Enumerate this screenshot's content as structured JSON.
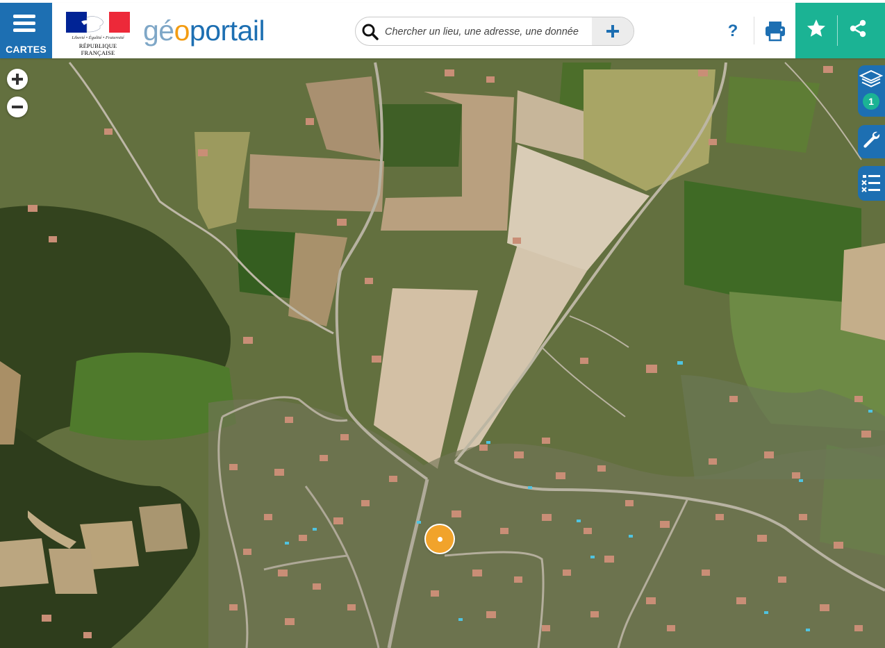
{
  "menu": {
    "label": "CARTES"
  },
  "branding": {
    "republic_devise": "Liberté • Égalité • Fraternité",
    "republic_name": "RÉPUBLIQUE FRANÇAISE",
    "logo_parts": [
      "gé",
      "o",
      "portail"
    ]
  },
  "search": {
    "placeholder": "Chercher un lieu, une adresse, une donnée",
    "value": ""
  },
  "toolbar": {
    "help_label": "?",
    "icons": [
      "print-icon",
      "star-icon",
      "share-icon"
    ]
  },
  "map_controls": {
    "zoom_in": "zoom-in-icon",
    "zoom_out": "zoom-out-icon"
  },
  "side_tabs": [
    {
      "icon": "layers-icon",
      "badge": "1"
    },
    {
      "icon": "wrench-icon"
    },
    {
      "icon": "legend-list-icon"
    }
  ],
  "colors": {
    "brand_blue": "#1d6fb2",
    "accent_green": "#1bb394",
    "marker_orange": "#f1a32b",
    "logo_orange": "#f39c12",
    "logo_light_blue": "#7fa7c7"
  }
}
